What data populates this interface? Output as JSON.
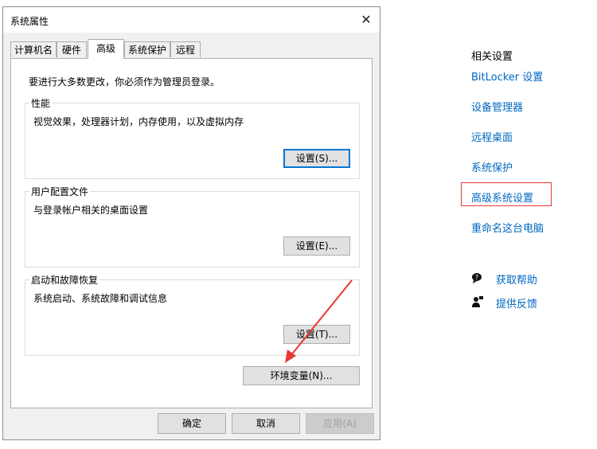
{
  "dialog": {
    "title": "系统属性",
    "close_symbol": "✕",
    "tabs": [
      "计算机名",
      "硬件",
      "高级",
      "系统保护",
      "远程"
    ],
    "active_tab_index": 2,
    "notice": "要进行大多数更改，你必须作为管理员登录。",
    "groups": {
      "performance": {
        "legend": "性能",
        "description": "视觉效果，处理器计划，内存使用，以及虚拟内存",
        "button": "设置(S)..."
      },
      "profiles": {
        "legend": "用户配置文件",
        "description": "与登录帐户相关的桌面设置",
        "button": "设置(E)..."
      },
      "startup": {
        "legend": "启动和故障恢复",
        "description": "系统启动、系统故障和调试信息",
        "button": "设置(T)..."
      }
    },
    "env_button": "环境变量(N)...",
    "footer": {
      "ok": "确定",
      "cancel": "取消",
      "apply": "应用(A)"
    }
  },
  "related_settings": {
    "heading": "相关设置",
    "links": [
      "BitLocker 设置",
      "设备管理器",
      "远程桌面",
      "系统保护",
      "高级系统设置",
      "重命名这台电脑"
    ],
    "highlighted_index": 4,
    "help": {
      "get_help": "获取帮助",
      "feedback": "提供反馈"
    }
  },
  "colors": {
    "link": "#0067c0",
    "highlight_border": "#e53935",
    "arrow": "#e53935",
    "focus": "#0078d7"
  }
}
